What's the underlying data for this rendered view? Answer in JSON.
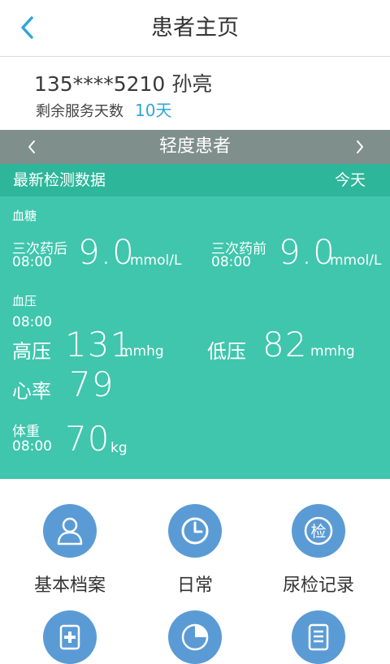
{
  "header": {
    "title": "患者主页"
  },
  "patient": {
    "phone": "135****5210",
    "name": "孙亮",
    "remaining_label": "剩余服务天数",
    "remaining_days": "10天"
  },
  "level": {
    "title": "轻度患者"
  },
  "latest": {
    "title": "最新检测数据",
    "date": "今天",
    "blood_sugar": {
      "label": "血糖",
      "after": {
        "label": "三次药后",
        "time": "08:00",
        "value": "9.0",
        "unit": "mmol/L"
      },
      "before": {
        "label": "三次药前",
        "time": "08:00",
        "value": "9.0",
        "unit": "mmol/L"
      }
    },
    "blood_pressure": {
      "label": "血压",
      "time": "08:00",
      "high_label": "高压",
      "high_value": "131",
      "high_unit": "mmhg",
      "low_label": "低压",
      "low_value": "82",
      "low_unit": "mmhg",
      "heart_label": "心率",
      "heart_value": "79"
    },
    "weight": {
      "label": "体重",
      "time": "08:00",
      "value": "70",
      "unit": "kg"
    }
  },
  "menu": [
    {
      "label": "基本档案",
      "icon": "person-icon"
    },
    {
      "label": "日常",
      "icon": "clock-icon"
    },
    {
      "label": "尿检记录",
      "icon": "check-icon",
      "icon_text": "检"
    },
    {
      "label": "",
      "icon": "medical-kit-icon"
    },
    {
      "label": "",
      "icon": "pie-chart-icon"
    },
    {
      "label": "",
      "icon": "document-list-icon"
    }
  ],
  "colors": {
    "accent": "#2ea6d9",
    "level_bar": "#7f8f8c",
    "data_head": "#2eb69a",
    "data_panel": "#3fc6ad",
    "icon_circle": "#5b9bd5"
  }
}
